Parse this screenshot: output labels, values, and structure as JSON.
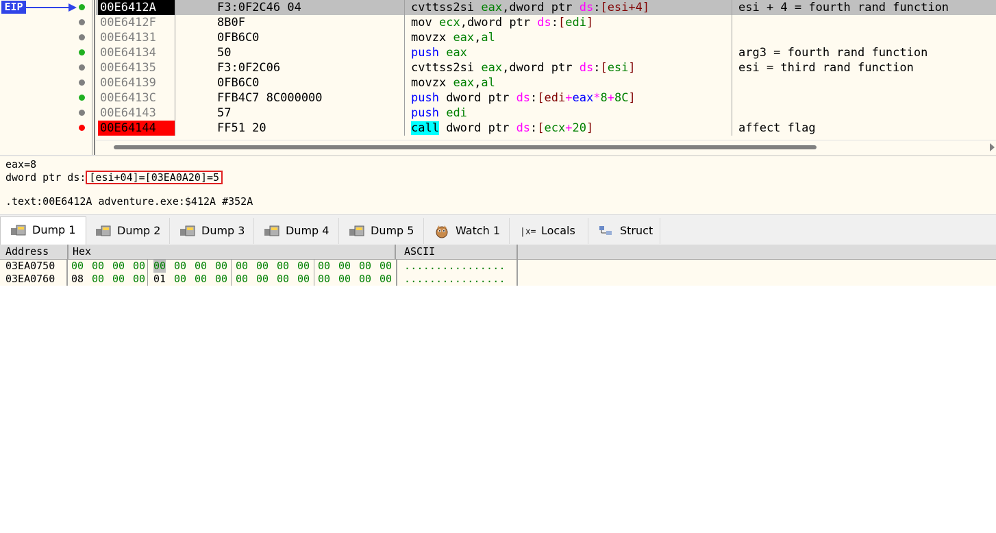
{
  "eip_label": "EIP",
  "disasm": {
    "rows": [
      {
        "addr": "00E6412A",
        "bytes": "F3:0F2C46 04",
        "comment": "esi + 4 = fourth rand function"
      },
      {
        "addr": "00E6412F",
        "bytes": "8B0F",
        "comment": ""
      },
      {
        "addr": "00E64131",
        "bytes": "0FB6C0",
        "comment": ""
      },
      {
        "addr": "00E64134",
        "bytes": "50",
        "comment": "arg3 = fourth rand function"
      },
      {
        "addr": "00E64135",
        "bytes": "F3:0F2C06",
        "comment": "esi = third rand function"
      },
      {
        "addr": "00E64139",
        "bytes": "0FB6C0",
        "comment": ""
      },
      {
        "addr": "00E6413C",
        "bytes": "FFB4C7 8C000000",
        "comment": ""
      },
      {
        "addr": "00E64143",
        "bytes": "57",
        "comment": ""
      },
      {
        "addr": "00E64144",
        "bytes": "FF51 20",
        "comment": "affect flag"
      }
    ],
    "instructions": [
      {
        "mnemonic": "cvttss2si",
        "reg": "eax",
        "sep": ",",
        "size": "dword ptr ",
        "seg": "ds",
        "colon": ":",
        "open": "[",
        "inner": "esi+4",
        "close": "]"
      },
      {
        "mnemonic": "mov",
        "reg": "ecx",
        "sep": ",",
        "size": "dword ptr ",
        "seg": "ds",
        "colon": ":",
        "open": "[",
        "inner": "edi",
        "close": "]"
      },
      {
        "mnemonic": "movzx",
        "reg": "eax",
        "sep": ",",
        "operand2": "al"
      },
      {
        "mnemonic": "push",
        "reg": "eax"
      },
      {
        "mnemonic": "cvttss2si",
        "reg": "eax",
        "sep": ",",
        "size": "dword ptr ",
        "seg": "ds",
        "colon": ":",
        "open": "[",
        "inner": "esi",
        "close": "]"
      },
      {
        "mnemonic": "movzx",
        "reg": "eax",
        "sep": ",",
        "operand2": "al"
      },
      {
        "mnemonic": "push",
        "size": "dword ptr ",
        "seg": "ds",
        "colon": ":",
        "open": "[",
        "edi": "edi",
        "plus1": "+",
        "eax": "eax",
        "star": "*",
        "scale": "8",
        "plus2": "+",
        "disp": "8C",
        "close": "]"
      },
      {
        "mnemonic": "push",
        "reg": "edi"
      },
      {
        "mnemonic": "call",
        "size": "dword ptr ",
        "seg": "ds",
        "colon": ":",
        "open": "[",
        "ecx": "ecx",
        "plus": "+",
        "disp": "20",
        "close": "]"
      }
    ]
  },
  "info": {
    "line1": "eax=8",
    "line2_prefix": "dword ptr ds:",
    "line2_box": "[esi+04]=[03EA0A20]=5",
    "line3": ".text:00E6412A adventure.exe:$412A #352A"
  },
  "tabs": [
    {
      "label": "Dump 1",
      "icon": "dump-icon",
      "active": true
    },
    {
      "label": "Dump 2",
      "icon": "dump-icon"
    },
    {
      "label": "Dump 3",
      "icon": "dump-icon"
    },
    {
      "label": "Dump 4",
      "icon": "dump-icon"
    },
    {
      "label": "Dump 5",
      "icon": "dump-icon"
    },
    {
      "label": "Watch 1",
      "icon": "watch-icon"
    },
    {
      "label": "Locals",
      "icon": "locals-icon"
    },
    {
      "label": "Struct",
      "icon": "struct-icon"
    }
  ],
  "dump": {
    "headers": {
      "address": "Address",
      "hex": "Hex",
      "ascii": "ASCII"
    },
    "rows": [
      {
        "addr": "03EA0750",
        "bytes": [
          "00",
          "00",
          "00",
          "00",
          "00",
          "00",
          "00",
          "00",
          "00",
          "00",
          "00",
          "00",
          "00",
          "00",
          "00",
          "00"
        ],
        "ascii": "................"
      },
      {
        "addr": "03EA0760",
        "bytes": [
          "08",
          "00",
          "00",
          "00",
          "01",
          "00",
          "00",
          "00",
          "00",
          "00",
          "00",
          "00",
          "00",
          "00",
          "00",
          "00"
        ],
        "ascii": "................"
      }
    ]
  },
  "colors": {
    "eip_bg": "#3044e8",
    "breakpoint": "#ff0000",
    "call_highlight": "#00ffff",
    "register": "#008000",
    "segment": "#ff00ff",
    "info_box_border": "#e02020"
  }
}
